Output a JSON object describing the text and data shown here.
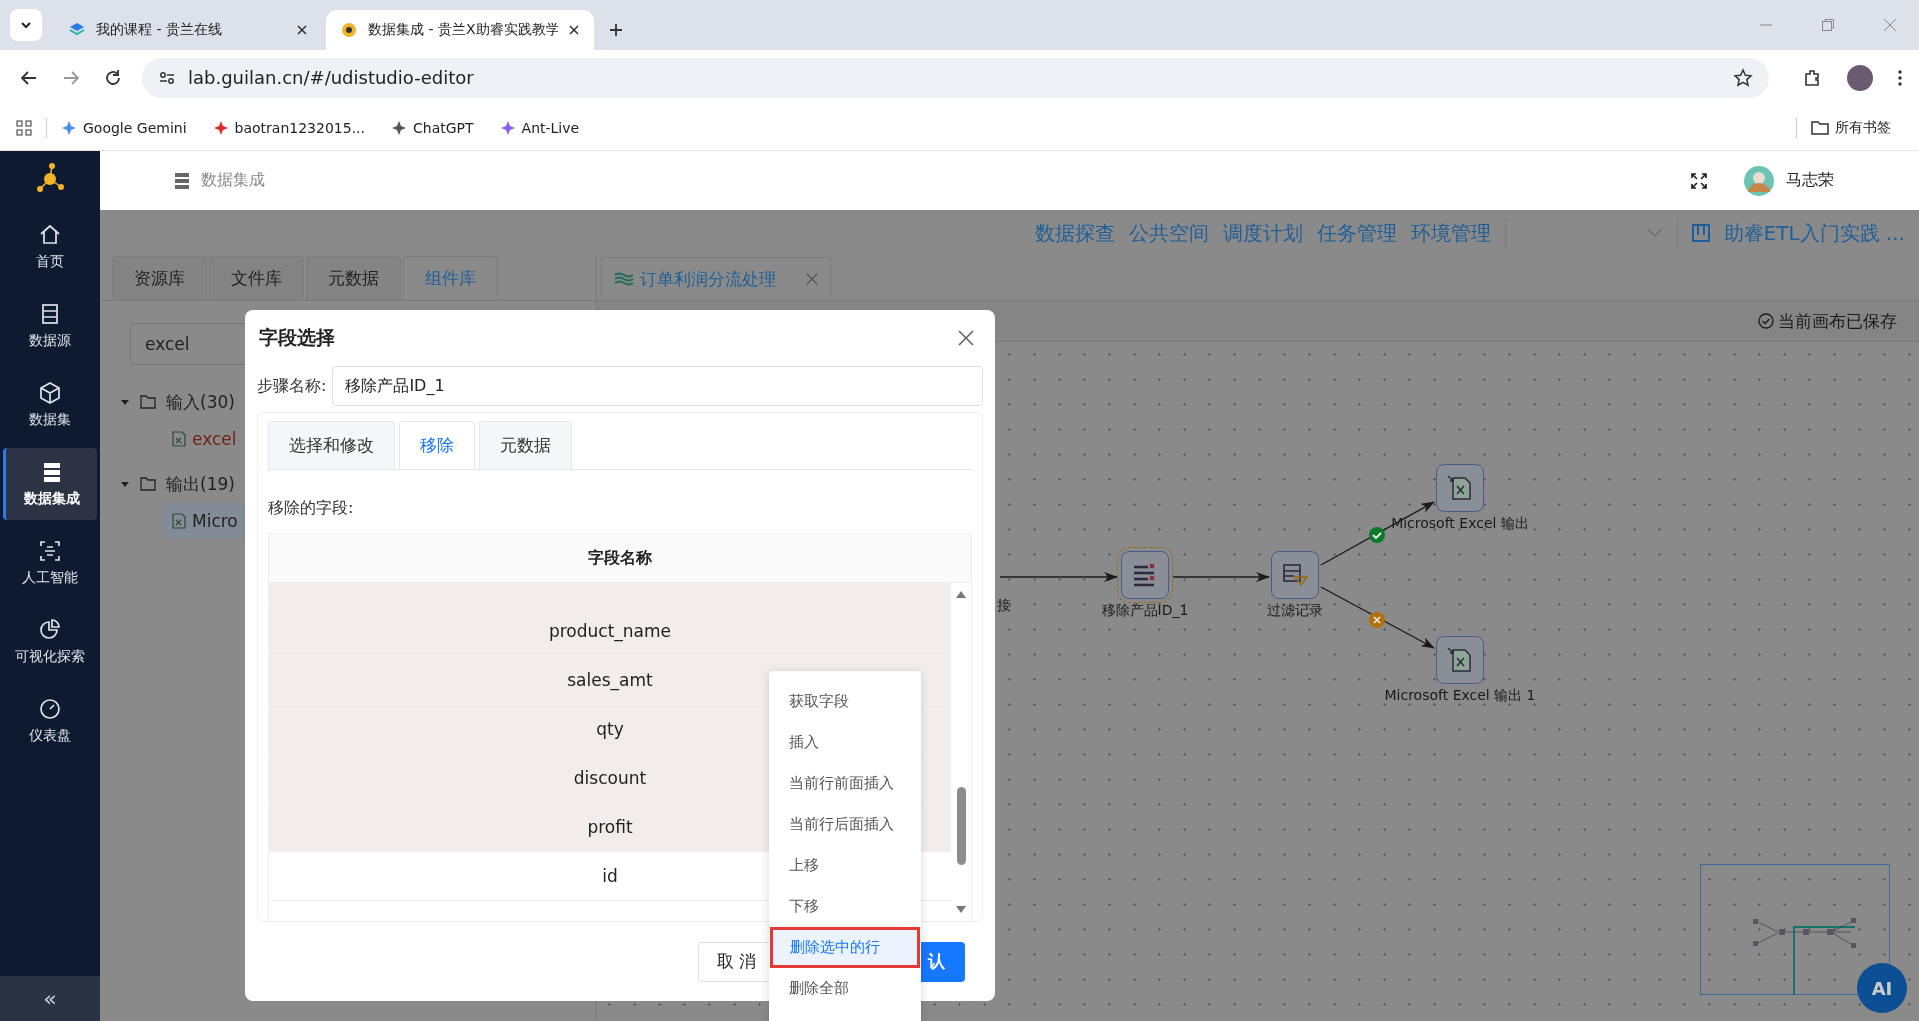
{
  "browser": {
    "tabs": [
      {
        "title": "我的课程 - 贵兰在线",
        "selected": false
      },
      {
        "title": "数据集成 - 贵兰X助睿实践教学",
        "selected": true
      }
    ],
    "address": "lab.guilan.cn/#/udistudio-editor",
    "bookmarks": [
      "Google Gemini",
      "baotran1232015...",
      "ChatGPT",
      "Ant-Live"
    ],
    "all_bookmarks": "所有书签"
  },
  "sidebar": {
    "items": [
      {
        "label": "首页",
        "selected": false
      },
      {
        "label": "数据源",
        "selected": false
      },
      {
        "label": "数据集",
        "selected": false
      },
      {
        "label": "数据集成",
        "selected": true
      },
      {
        "label": "人工智能",
        "selected": false
      },
      {
        "label": "可视化探索",
        "selected": false
      },
      {
        "label": "仪表盘",
        "selected": false
      }
    ],
    "collapse": "«"
  },
  "header": {
    "title": "数据集成",
    "user": "马志荣"
  },
  "top_menu": {
    "items": [
      "数据探查",
      "公共空间",
      "调度计划",
      "任务管理",
      "环境管理"
    ],
    "project": "助睿ETL入门实践 ..."
  },
  "left_panel": {
    "tabs": [
      {
        "label": "资源库",
        "selected": false
      },
      {
        "label": "文件库",
        "selected": false
      },
      {
        "label": "元数据",
        "selected": false
      },
      {
        "label": "组件库",
        "selected": true
      }
    ],
    "search": {
      "value": "excel"
    },
    "tree": [
      {
        "label": "输入(30)",
        "expanded": true,
        "children": [
          {
            "label": "excel",
            "selected": false
          }
        ]
      },
      {
        "label": "输出(19)",
        "expanded": true,
        "children": [
          {
            "label": "Micro",
            "selected": true
          }
        ]
      }
    ]
  },
  "editor": {
    "tab": "订单利润分流处理",
    "status": "当前画布已保存",
    "nodes": [
      {
        "label": "接",
        "kind": "cut"
      },
      {
        "label": "移除产品ID_1",
        "kind": "remove"
      },
      {
        "label": "过滤记录",
        "kind": "filter"
      },
      {
        "label": "Microsoft Excel 输出",
        "kind": "excel"
      },
      {
        "label": "Microsoft Excel 输出 1",
        "kind": "excel"
      }
    ],
    "ai_button": "AI"
  },
  "dialog": {
    "title": "字段选择",
    "step_label": "步骤名称:",
    "step_name": "移除产品ID_1",
    "tabs": [
      {
        "label": "选择和修改",
        "selected": false
      },
      {
        "label": "移除",
        "selected": true
      },
      {
        "label": "元数据",
        "selected": false
      }
    ],
    "section_label": "移除的字段:",
    "column": "字段名称",
    "rows": [
      {
        "name": "product_name",
        "selected": true
      },
      {
        "name": "sales_amt",
        "selected": true
      },
      {
        "name": "qty",
        "selected": true
      },
      {
        "name": "discount",
        "selected": true
      },
      {
        "name": "profit",
        "selected": true
      },
      {
        "name": "id",
        "selected": false
      }
    ],
    "cancel": "取 消",
    "confirm": "认"
  },
  "context_menu": [
    {
      "label": "获取字段",
      "selected": false
    },
    {
      "label": "插入",
      "selected": false
    },
    {
      "label": "当前行前面插入",
      "selected": false
    },
    {
      "label": "当前行后面插入",
      "selected": false
    },
    {
      "label": "上移",
      "selected": false
    },
    {
      "label": "下移",
      "selected": false
    },
    {
      "label": "删除选中的行",
      "selected": true
    },
    {
      "label": "删除全部",
      "selected": false
    }
  ]
}
